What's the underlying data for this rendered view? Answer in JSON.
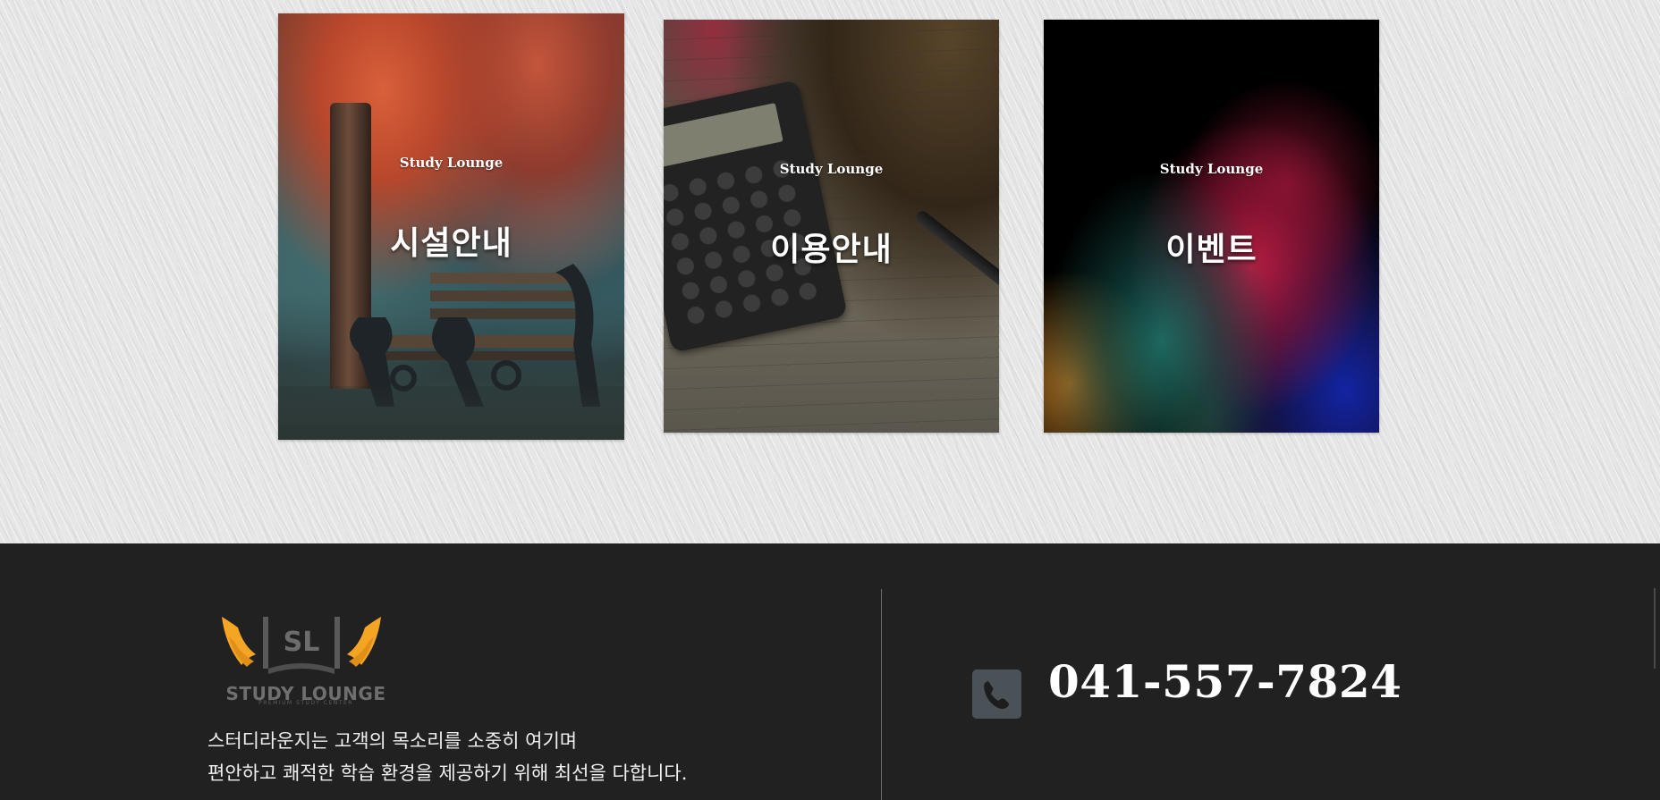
{
  "cards": [
    {
      "eyebrow": "Study Lounge",
      "title": "시설안내"
    },
    {
      "eyebrow": "Study Lounge",
      "title": "이용안내"
    },
    {
      "eyebrow": "Study Lounge",
      "title": "이벤트"
    }
  ],
  "footer": {
    "logo_text": "STUDY LOUNGE",
    "logo_subtext": "PREMIUM STUDY CENTER",
    "logo_monogram": "SL",
    "description_line1": "스터디라운지는 고객의 목소리를 소중히 여기며",
    "description_line2": "편안하고 쾌적한 학습 환경을 제공하기 위해 최선을 다합니다.",
    "phone": "041-557-7824",
    "phone_icon": "phone-icon"
  },
  "colors": {
    "footer_bg": "#212121",
    "logo_wing": "#f5a524",
    "phone_icon_bg": "#4b5257"
  }
}
